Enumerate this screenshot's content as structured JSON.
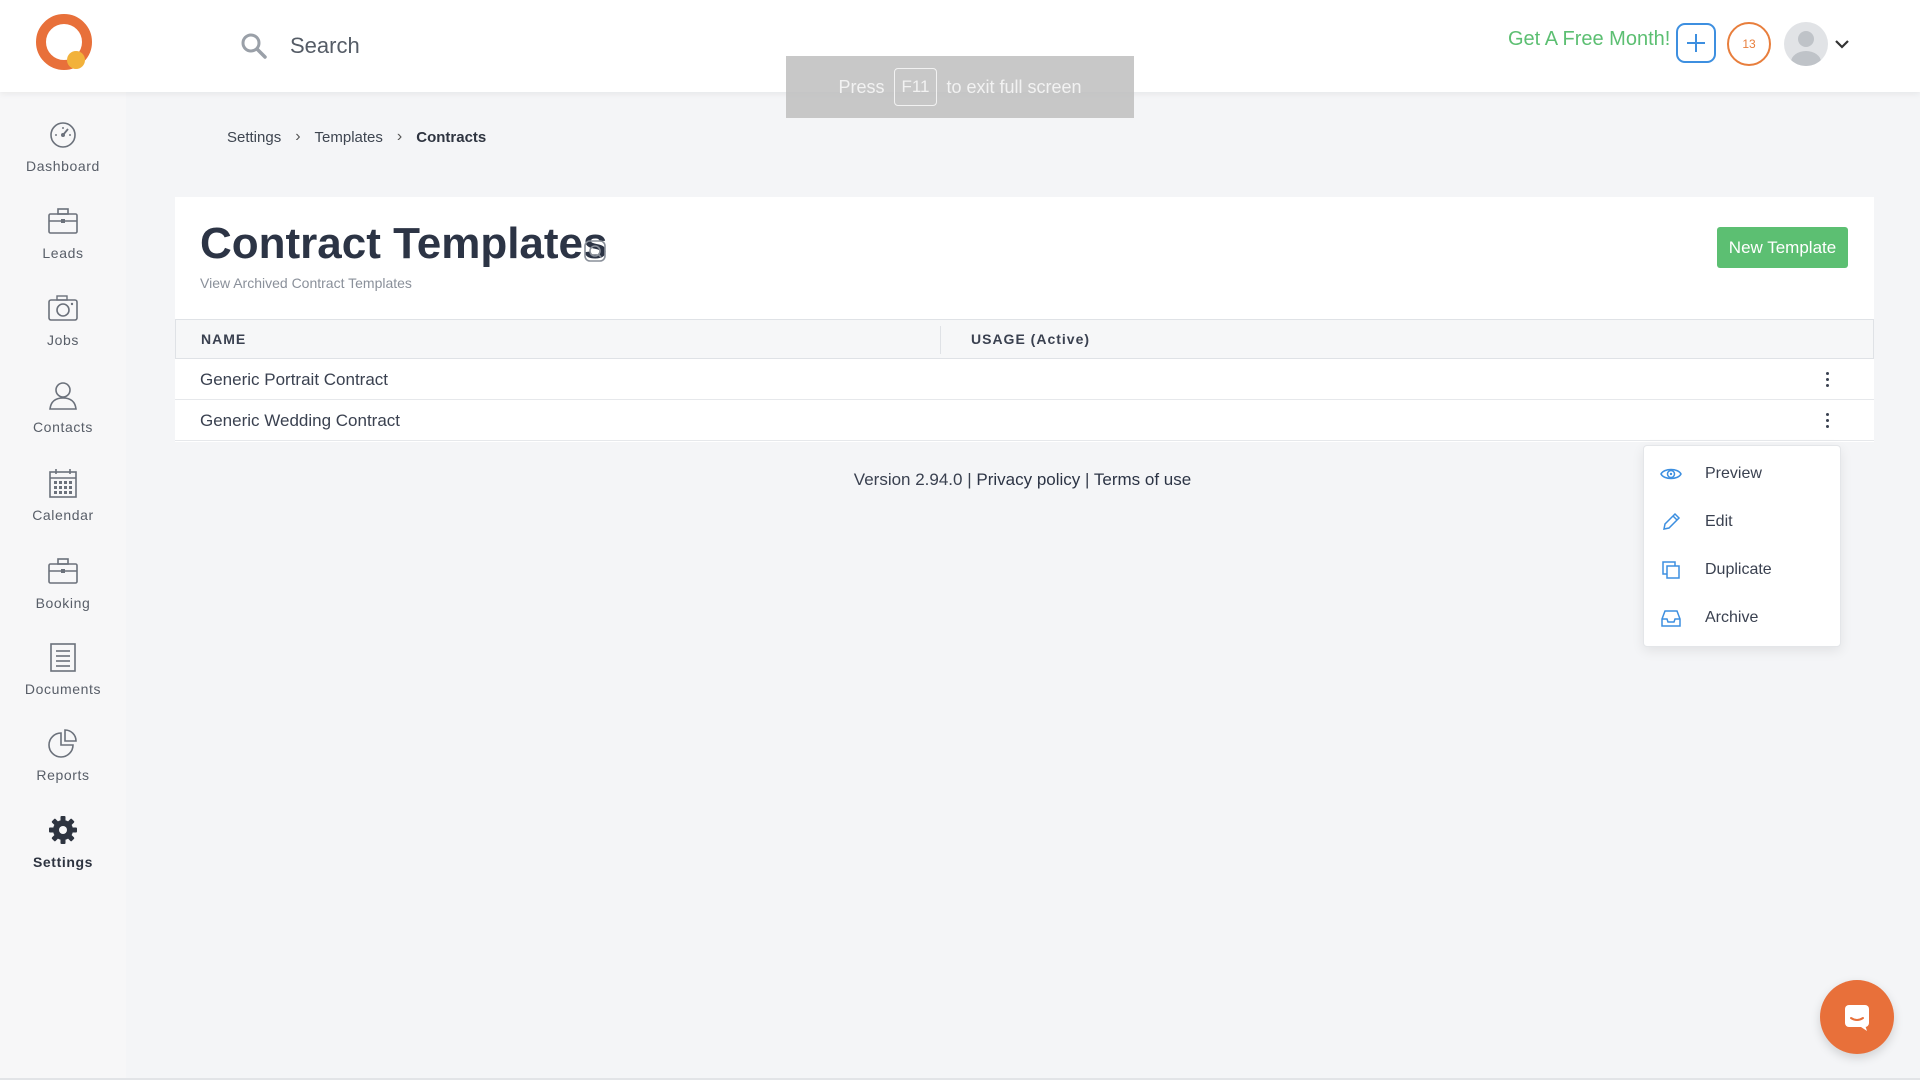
{
  "header": {
    "search_placeholder": "Search",
    "promo": "Get A Free Month!",
    "notification_count": "13",
    "accent_color": "#5cbf72",
    "brand_color": "#e87e3c"
  },
  "fullscreen_banner": {
    "press": "Press",
    "key": "F11",
    "message": "to exit full screen"
  },
  "sidebar": {
    "items": [
      {
        "label": "Dashboard",
        "icon": "dashboard-icon"
      },
      {
        "label": "Leads",
        "icon": "briefcase-icon"
      },
      {
        "label": "Jobs",
        "icon": "camera-icon"
      },
      {
        "label": "Contacts",
        "icon": "person-icon"
      },
      {
        "label": "Calendar",
        "icon": "calendar-icon"
      },
      {
        "label": "Booking",
        "icon": "briefcase-icon"
      },
      {
        "label": "Documents",
        "icon": "document-icon"
      },
      {
        "label": "Reports",
        "icon": "pie-chart-icon"
      },
      {
        "label": "Settings",
        "icon": "gear-icon",
        "active": true
      }
    ]
  },
  "breadcrumb": {
    "items": [
      "Settings",
      "Templates",
      "Contracts"
    ],
    "separator": "›"
  },
  "page": {
    "title": "Contract Templates",
    "archived_link": "View Archived Contract Templates",
    "new_button": "New Template"
  },
  "table": {
    "columns": [
      "NAME",
      "USAGE (Active)"
    ],
    "rows": [
      {
        "name": "Generic Portrait Contract"
      },
      {
        "name": "Generic Wedding Contract"
      }
    ]
  },
  "footer": {
    "version": "Version 2.94.0 |",
    "privacy": "Privacy policy",
    "divider": "|",
    "terms": "Terms of use"
  },
  "dropdown": {
    "items": [
      {
        "label": "Preview",
        "icon": "eye-icon"
      },
      {
        "label": "Edit",
        "icon": "pencil-icon"
      },
      {
        "label": "Duplicate",
        "icon": "copy-icon"
      },
      {
        "label": "Archive",
        "icon": "archive-icon"
      }
    ]
  }
}
